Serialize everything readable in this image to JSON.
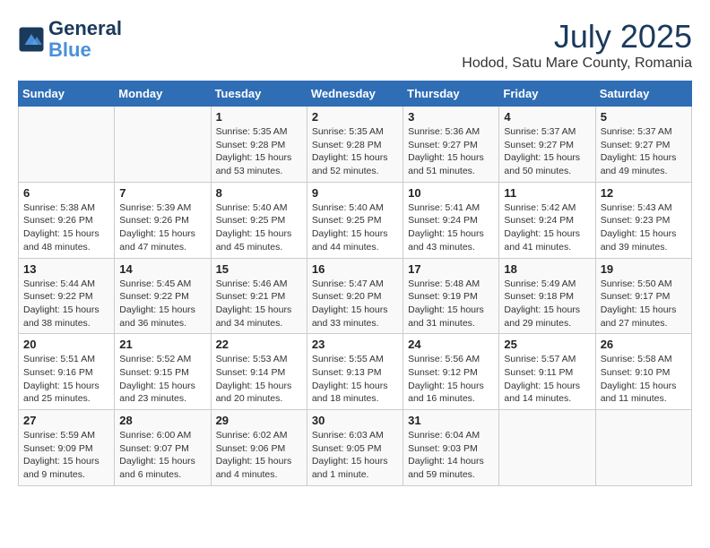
{
  "header": {
    "logo_line1": "General",
    "logo_line2": "Blue",
    "month_title": "July 2025",
    "location": "Hodod, Satu Mare County, Romania"
  },
  "weekdays": [
    "Sunday",
    "Monday",
    "Tuesday",
    "Wednesday",
    "Thursday",
    "Friday",
    "Saturday"
  ],
  "weeks": [
    [
      {
        "day": "",
        "info": ""
      },
      {
        "day": "",
        "info": ""
      },
      {
        "day": "1",
        "info": "Sunrise: 5:35 AM\nSunset: 9:28 PM\nDaylight: 15 hours\nand 53 minutes."
      },
      {
        "day": "2",
        "info": "Sunrise: 5:35 AM\nSunset: 9:28 PM\nDaylight: 15 hours\nand 52 minutes."
      },
      {
        "day": "3",
        "info": "Sunrise: 5:36 AM\nSunset: 9:27 PM\nDaylight: 15 hours\nand 51 minutes."
      },
      {
        "day": "4",
        "info": "Sunrise: 5:37 AM\nSunset: 9:27 PM\nDaylight: 15 hours\nand 50 minutes."
      },
      {
        "day": "5",
        "info": "Sunrise: 5:37 AM\nSunset: 9:27 PM\nDaylight: 15 hours\nand 49 minutes."
      }
    ],
    [
      {
        "day": "6",
        "info": "Sunrise: 5:38 AM\nSunset: 9:26 PM\nDaylight: 15 hours\nand 48 minutes."
      },
      {
        "day": "7",
        "info": "Sunrise: 5:39 AM\nSunset: 9:26 PM\nDaylight: 15 hours\nand 47 minutes."
      },
      {
        "day": "8",
        "info": "Sunrise: 5:40 AM\nSunset: 9:25 PM\nDaylight: 15 hours\nand 45 minutes."
      },
      {
        "day": "9",
        "info": "Sunrise: 5:40 AM\nSunset: 9:25 PM\nDaylight: 15 hours\nand 44 minutes."
      },
      {
        "day": "10",
        "info": "Sunrise: 5:41 AM\nSunset: 9:24 PM\nDaylight: 15 hours\nand 43 minutes."
      },
      {
        "day": "11",
        "info": "Sunrise: 5:42 AM\nSunset: 9:24 PM\nDaylight: 15 hours\nand 41 minutes."
      },
      {
        "day": "12",
        "info": "Sunrise: 5:43 AM\nSunset: 9:23 PM\nDaylight: 15 hours\nand 39 minutes."
      }
    ],
    [
      {
        "day": "13",
        "info": "Sunrise: 5:44 AM\nSunset: 9:22 PM\nDaylight: 15 hours\nand 38 minutes."
      },
      {
        "day": "14",
        "info": "Sunrise: 5:45 AM\nSunset: 9:22 PM\nDaylight: 15 hours\nand 36 minutes."
      },
      {
        "day": "15",
        "info": "Sunrise: 5:46 AM\nSunset: 9:21 PM\nDaylight: 15 hours\nand 34 minutes."
      },
      {
        "day": "16",
        "info": "Sunrise: 5:47 AM\nSunset: 9:20 PM\nDaylight: 15 hours\nand 33 minutes."
      },
      {
        "day": "17",
        "info": "Sunrise: 5:48 AM\nSunset: 9:19 PM\nDaylight: 15 hours\nand 31 minutes."
      },
      {
        "day": "18",
        "info": "Sunrise: 5:49 AM\nSunset: 9:18 PM\nDaylight: 15 hours\nand 29 minutes."
      },
      {
        "day": "19",
        "info": "Sunrise: 5:50 AM\nSunset: 9:17 PM\nDaylight: 15 hours\nand 27 minutes."
      }
    ],
    [
      {
        "day": "20",
        "info": "Sunrise: 5:51 AM\nSunset: 9:16 PM\nDaylight: 15 hours\nand 25 minutes."
      },
      {
        "day": "21",
        "info": "Sunrise: 5:52 AM\nSunset: 9:15 PM\nDaylight: 15 hours\nand 23 minutes."
      },
      {
        "day": "22",
        "info": "Sunrise: 5:53 AM\nSunset: 9:14 PM\nDaylight: 15 hours\nand 20 minutes."
      },
      {
        "day": "23",
        "info": "Sunrise: 5:55 AM\nSunset: 9:13 PM\nDaylight: 15 hours\nand 18 minutes."
      },
      {
        "day": "24",
        "info": "Sunrise: 5:56 AM\nSunset: 9:12 PM\nDaylight: 15 hours\nand 16 minutes."
      },
      {
        "day": "25",
        "info": "Sunrise: 5:57 AM\nSunset: 9:11 PM\nDaylight: 15 hours\nand 14 minutes."
      },
      {
        "day": "26",
        "info": "Sunrise: 5:58 AM\nSunset: 9:10 PM\nDaylight: 15 hours\nand 11 minutes."
      }
    ],
    [
      {
        "day": "27",
        "info": "Sunrise: 5:59 AM\nSunset: 9:09 PM\nDaylight: 15 hours\nand 9 minutes."
      },
      {
        "day": "28",
        "info": "Sunrise: 6:00 AM\nSunset: 9:07 PM\nDaylight: 15 hours\nand 6 minutes."
      },
      {
        "day": "29",
        "info": "Sunrise: 6:02 AM\nSunset: 9:06 PM\nDaylight: 15 hours\nand 4 minutes."
      },
      {
        "day": "30",
        "info": "Sunrise: 6:03 AM\nSunset: 9:05 PM\nDaylight: 15 hours\nand 1 minute."
      },
      {
        "day": "31",
        "info": "Sunrise: 6:04 AM\nSunset: 9:03 PM\nDaylight: 14 hours\nand 59 minutes."
      },
      {
        "day": "",
        "info": ""
      },
      {
        "day": "",
        "info": ""
      }
    ]
  ]
}
